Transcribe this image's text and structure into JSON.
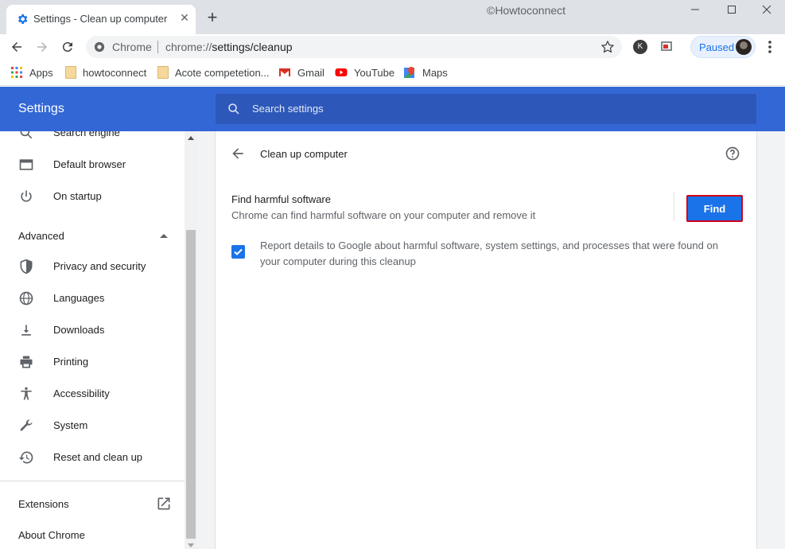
{
  "window": {
    "tab_title": "Settings - Clean up computer",
    "watermark": "©Howtoconnect"
  },
  "toolbar": {
    "omnibox_chrome": "Chrome",
    "url_prefix": "chrome://",
    "url_path": "settings/cleanup",
    "profile_label": "Paused",
    "extension_letter": "K"
  },
  "bookmarks": [
    {
      "label": "Apps",
      "icon": "apps-grid-icon"
    },
    {
      "label": "howtoconnect",
      "icon": "folder-icon"
    },
    {
      "label": "Acote competetion...",
      "icon": "folder-icon"
    },
    {
      "label": "Gmail",
      "icon": "gmail-icon"
    },
    {
      "label": "YouTube",
      "icon": "youtube-icon"
    },
    {
      "label": "Maps",
      "icon": "maps-icon"
    }
  ],
  "header": {
    "title": "Settings",
    "search_placeholder": "Search settings"
  },
  "sidebar": {
    "items": [
      {
        "label": "Search engine",
        "icon": "search-icon"
      },
      {
        "label": "Default browser",
        "icon": "browser-icon"
      },
      {
        "label": "On startup",
        "icon": "power-icon"
      },
      {
        "label": "Privacy and security",
        "icon": "shield-icon"
      },
      {
        "label": "Languages",
        "icon": "globe-icon"
      },
      {
        "label": "Downloads",
        "icon": "download-icon"
      },
      {
        "label": "Printing",
        "icon": "printer-icon"
      },
      {
        "label": "Accessibility",
        "icon": "accessibility-icon"
      },
      {
        "label": "System",
        "icon": "wrench-icon"
      },
      {
        "label": "Reset and clean up",
        "icon": "restore-icon"
      }
    ],
    "advanced_label": "Advanced",
    "extensions_label": "Extensions",
    "about_label": "About Chrome"
  },
  "main": {
    "page_title": "Clean up computer",
    "find_title": "Find harmful software",
    "find_subtitle": "Chrome can find harmful software on your computer and remove it",
    "find_button": "Find",
    "report_checked": true,
    "report_text": "Report details to Google about harmful software, system settings, and processes that were found on your computer during this cleanup"
  },
  "colors": {
    "header_blue": "#3367d6",
    "accent_blue": "#1a73e8",
    "highlight_red": "#d0021b"
  }
}
